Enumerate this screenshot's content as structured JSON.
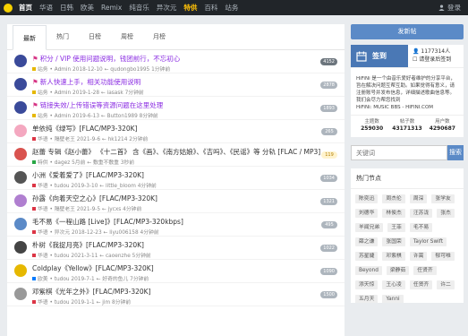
{
  "nav": {
    "items": [
      "首页",
      "华语",
      "日韩",
      "欧美",
      "Remix",
      "纯音乐",
      "异次元",
      "特供",
      "百科",
      "站务"
    ],
    "active_index": 0,
    "highlight_index": 7,
    "login_label": "登录"
  },
  "tabs": [
    "最新",
    "热门",
    "日榜",
    "周榜",
    "月榜"
  ],
  "threads": [
    {
      "title": "积分 / VIP 使用问题说明，钱团前行，不忘初心",
      "flag": true,
      "style": "purple",
      "avatar": "#3a4a9a",
      "cat": "站务",
      "cat_color": "#e6b800",
      "author": "Admin",
      "date": "2018-12-10",
      "last": "qudongbo1995",
      "ago": "1分钟前",
      "count": "4152",
      "count_style": "dark"
    },
    {
      "title": "新人快速上手，相关功能使用说明",
      "flag": true,
      "style": "purple",
      "avatar": "#3a4a9a",
      "cat": "站务",
      "cat_color": "#e6b800",
      "author": "Admin",
      "date": "2019-1-28",
      "last": "iasask",
      "ago": "7分钟前",
      "count": "2878",
      "count_style": ""
    },
    {
      "title": "链接失效/上传错误等资源问题在这里处理",
      "flag": true,
      "style": "purple",
      "avatar": "#3a4a9a",
      "cat": "站务",
      "cat_color": "#e6b800",
      "author": "Admin",
      "date": "2019-6-13",
      "last": "Button1989",
      "ago": "8分钟前",
      "count": "1893",
      "count_style": ""
    },
    {
      "title": "单依纯《绿写》[FLAC/MP3-320K]",
      "flag": false,
      "style": "",
      "avatar": "#f4a8c0",
      "cat": "华语",
      "cat_color": "#dc3545",
      "author": "隔壁老王",
      "date": "2021-9-6",
      "last": "hk1214",
      "ago": "2分钟前",
      "count": "265",
      "count_style": ""
    },
    {
      "title": "赵蕾 专辑《赵小蕾》 《十二首》 含《画》、《南方姑娘》、《吉吗》、《民谣》等 分轨 [FLAC / MP3]",
      "flag": false,
      "style": "",
      "avatar": "#d9534f",
      "cat": "特供",
      "cat_color": "#28a745",
      "author": "dagez",
      "date": "5月前",
      "last": "敷重不敷重",
      "ago": "3秒前",
      "count": "119",
      "count_style": "warn"
    },
    {
      "title": "小洲《爱着爱了》[FLAC/MP3-320K]",
      "flag": false,
      "style": "",
      "avatar": "#555",
      "cat": "华语",
      "cat_color": "#dc3545",
      "author": "tudou",
      "date": "2019-3-10",
      "last": "little_bloom",
      "ago": "4分钟前",
      "count": "1034",
      "count_style": ""
    },
    {
      "title": "孙露《向着天空之心》[FLAC/MP3-320K]",
      "flag": false,
      "style": "",
      "avatar": "#b07fd0",
      "cat": "华语",
      "cat_color": "#dc3545",
      "author": "隔壁老王",
      "date": "2021-9-5",
      "last": "jycxs",
      "ago": "4分钟前",
      "count": "1321",
      "count_style": ""
    },
    {
      "title": "毛不易《一程山路 [Live]》[FLAC/MP3-320kbps]",
      "flag": false,
      "style": "",
      "avatar": "#5b8ac7",
      "cat": "华语",
      "cat_color": "#dc3545",
      "author": "异次元",
      "date": "2018-12-23",
      "last": "liyu006158",
      "ago": "4分钟前",
      "count": "495",
      "count_style": ""
    },
    {
      "title": "朴树《我捉月亮》[FLAC/MP3-320K]",
      "flag": false,
      "style": "",
      "avatar": "#444",
      "cat": "华语",
      "cat_color": "#dc3545",
      "author": "tudou",
      "date": "2021-3-11",
      "last": "caoenzhe",
      "ago": "5分钟前",
      "count": "1022",
      "count_style": ""
    },
    {
      "title": "Coldplay《Yellow》[FLAC/MP3-320K]",
      "flag": false,
      "style": "",
      "avatar": "#e6b800",
      "cat": "欧美",
      "cat_color": "#007bff",
      "author": "tudou",
      "date": "2019-7-1",
      "last": "好奇的鱼儿",
      "ago": "7分钟前",
      "count": "1090",
      "count_style": ""
    },
    {
      "title": "邓紫棋《光年之外》[FLAC/MP3-320K]",
      "flag": false,
      "style": "",
      "avatar": "#999",
      "cat": "华语",
      "cat_color": "#dc3545",
      "author": "tudou",
      "date": "2019-1-1",
      "last": "jim",
      "ago": "8分钟前",
      "count": "1500",
      "count_style": ""
    }
  ],
  "sidebar": {
    "post_button": "发新帖",
    "sign_label": "签到",
    "sign_count": "1177314人",
    "sign_hint": "请登录后签到",
    "intro": "HiFiNi 是一个由音乐爱好者维护的分享平台，旨在解决问题互帮互助。如果觉得有意义，请注册账号并发布信息，详细描述歌曲信息等。我们会尽力帮您找到",
    "intro_tail": "HiFiNi: MUSIC BBS - HIFINI.COM",
    "stats": [
      {
        "label": "主题数",
        "value": "259030"
      },
      {
        "label": "帖子数",
        "value": "43171313"
      },
      {
        "label": "用户数",
        "value": "4290687"
      }
    ],
    "search_placeholder": "关键词",
    "search_button": "搜索",
    "hot_title": "热门节点",
    "tags": [
      "陈奕迅",
      "周杰伦",
      "周深",
      "张学友",
      "刘德华",
      "林俊杰",
      "汪苏泷",
      "张杰",
      "羊闻兄弟",
      "王菲",
      "毛不易",
      "薛之谦",
      "张国荣",
      "Taylor Swift",
      "苏星婕",
      "邓紫棋",
      "许嵩",
      "郁可唯",
      "Beyond",
      "梁静茹",
      "任贤齐",
      "添天惊",
      "王心凌",
      "任贤齐",
      "许二",
      "五月天",
      "Yanni"
    ]
  }
}
